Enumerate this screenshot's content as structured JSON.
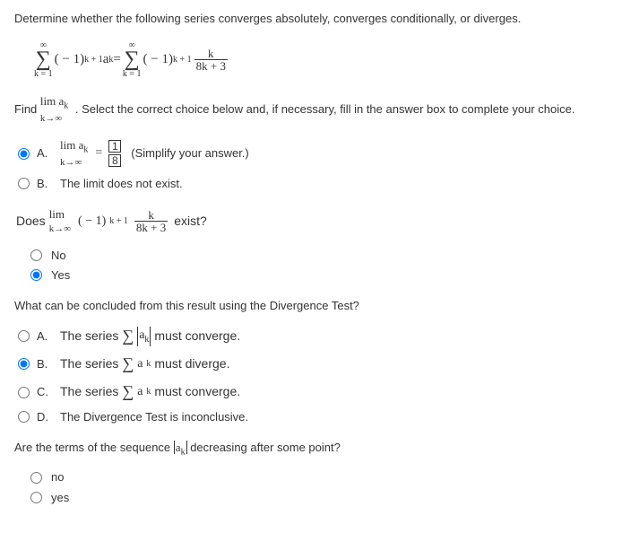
{
  "question": "Determine whether the following series converges absolutely, converges conditionally, or diverges.",
  "series": {
    "inf": "∞",
    "lhs_bottom": "k = 1",
    "lhs_term": "( − 1)",
    "lhs_exp": "k + 1",
    "lhs_ak": "a",
    "lhs_sub": "k",
    "eq": " = ",
    "rhs_bottom": "k = 1",
    "rhs_term": "( − 1)",
    "rhs_exp": "k + 1",
    "frac_num": "k",
    "frac_den": "8k + 3"
  },
  "prompt1": {
    "prefix": "Find ",
    "lim": "lim",
    "kto": "k→∞",
    "ak": "a",
    "ksub": "k",
    "suffix": ". Select the correct choice below and, if necessary, fill in the answer box to complete your choice."
  },
  "choices1": {
    "a_label": "A.",
    "a_lim": "lim",
    "a_kto": "k→∞",
    "a_ak": "a",
    "a_ksub": "k",
    "a_eq": " = ",
    "a_num": "1",
    "a_den": "8",
    "a_note": "(Simplify your answer.)",
    "b_label": "B.",
    "b_text": "The limit does not exist."
  },
  "prompt2": {
    "does": "Does ",
    "lim": "lim",
    "kto": "k→∞",
    "term": "( − 1)",
    "exp": "k + 1",
    "frac_num": "k",
    "frac_den": "8k + 3",
    "exist": " exist?"
  },
  "yn1": {
    "no": "No",
    "yes": "Yes"
  },
  "prompt3": "What can be concluded from this result using the Divergence Test?",
  "choices2": {
    "a_label": "A.",
    "a_pre": "The series ",
    "a_sum": "∑",
    "a_abs_ak": "a",
    "a_ksub": "k",
    "a_post": " must converge.",
    "b_label": "B.",
    "b_pre": "The series ",
    "b_sum": "∑",
    "b_ak": "a",
    "b_ksub": "k",
    "b_post": " must diverge.",
    "c_label": "C.",
    "c_pre": "The series ",
    "c_sum": "∑",
    "c_ak": "a",
    "c_ksub": "k",
    "c_post": " must converge.",
    "d_label": "D.",
    "d_text": "The Divergence Test is inconclusive."
  },
  "prompt4": {
    "pre": "Are the terms of the sequence ",
    "ak": "a",
    "ksub": "k",
    "post": " decreasing after some point?"
  },
  "yn2": {
    "no": "no",
    "yes": "yes"
  }
}
